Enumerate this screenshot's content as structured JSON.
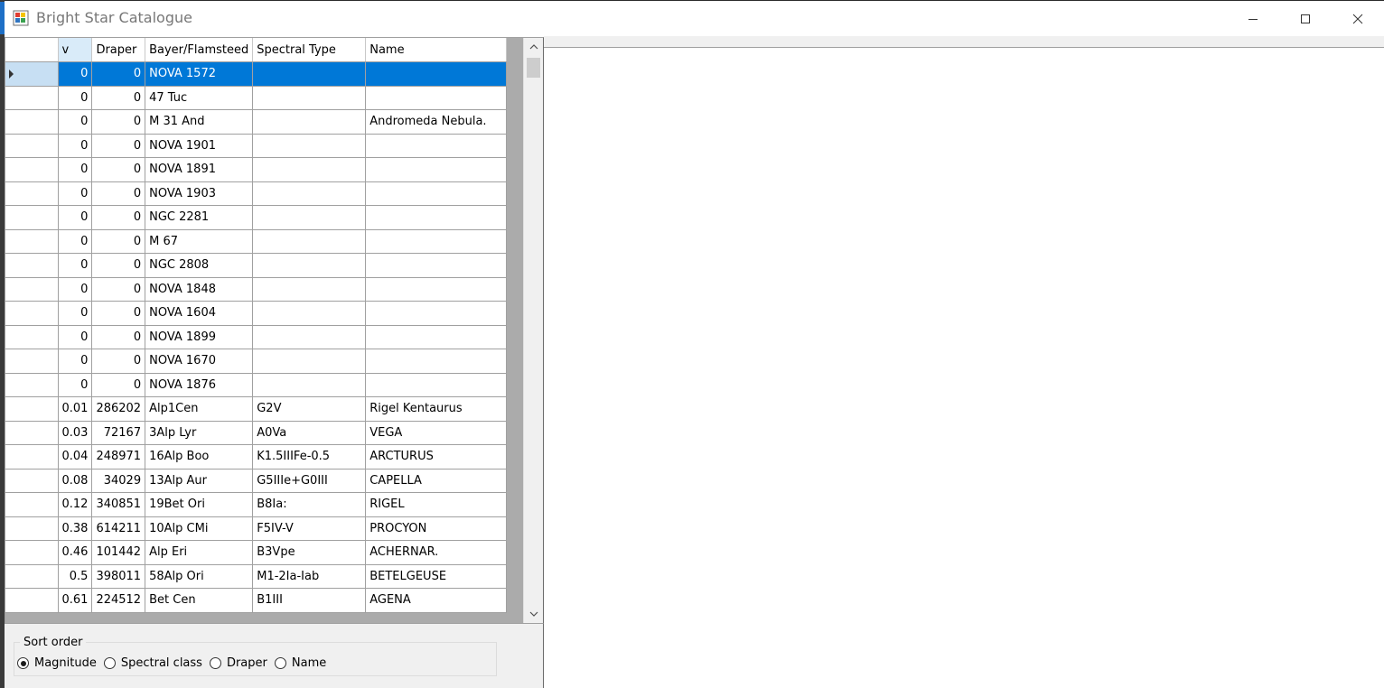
{
  "window": {
    "title": "Bright Star Catalogue"
  },
  "grid": {
    "columns": [
      "v",
      "Draper",
      "Bayer/Flamsteed",
      "Spectral Type",
      "Name"
    ],
    "rows": [
      [
        "0",
        "0",
        "NOVA 1572",
        "",
        ""
      ],
      [
        "0",
        "0",
        "47   Tuc",
        "",
        ""
      ],
      [
        "0",
        "0",
        "M 31  And",
        "",
        "Andromeda Nebula."
      ],
      [
        "0",
        "0",
        "NOVA 1901",
        "",
        ""
      ],
      [
        "0",
        "0",
        "NOVA 1891",
        "",
        ""
      ],
      [
        "0",
        "0",
        "NOVA 1903",
        "",
        ""
      ],
      [
        "0",
        "0",
        "NGC 2281",
        "",
        ""
      ],
      [
        "0",
        "0",
        "M 67",
        "",
        ""
      ],
      [
        "0",
        "0",
        "NGC 2808",
        "",
        ""
      ],
      [
        "0",
        "0",
        "NOVA 1848",
        "",
        ""
      ],
      [
        "0",
        "0",
        "NOVA 1604",
        "",
        ""
      ],
      [
        "0",
        "0",
        "NOVA 1899",
        "",
        ""
      ],
      [
        "0",
        "0",
        "NOVA 1670",
        "",
        ""
      ],
      [
        "0",
        "0",
        "NOVA 1876",
        "",
        ""
      ],
      [
        "0.01",
        "286202",
        "Alp1Cen",
        "G2V",
        "Rigel Kentaurus"
      ],
      [
        "0.03",
        "72167",
        "3Alp Lyr",
        "A0Va",
        "VEGA"
      ],
      [
        "0.04",
        "248971",
        "16Alp Boo",
        "K1.5IIIFe-0.5",
        "ARCTURUS"
      ],
      [
        "0.08",
        "34029",
        "13Alp Aur",
        "G5IIIe+G0III",
        "CAPELLA"
      ],
      [
        "0.12",
        "340851",
        "19Bet Ori",
        "B8Ia:",
        "RIGEL"
      ],
      [
        "0.38",
        "614211",
        "10Alp CMi",
        "F5IV-V",
        "PROCYON"
      ],
      [
        "0.46",
        "101442",
        "Alp Eri",
        "B3Vpe",
        "ACHERNAR."
      ],
      [
        "0.5",
        "398011",
        "58Alp Ori",
        "M1-2Ia-Iab",
        "BETELGEUSE"
      ],
      [
        "0.61",
        "224512",
        "Bet Cen",
        "B1III",
        "AGENA"
      ]
    ],
    "selected_row": 0
  },
  "sort": {
    "group_label": "Sort order",
    "options": [
      "Magnitude",
      "Spectral class",
      "Draper",
      "Name"
    ],
    "selected": "Magnitude"
  },
  "icons": {
    "app": "app-icon",
    "minimize": "minimize-icon",
    "maximize": "maximize-icon",
    "close": "close-icon"
  },
  "colors": {
    "selection": "#0078d7",
    "selected_header": "#d9ebf9",
    "grid_background": "#ababab"
  }
}
